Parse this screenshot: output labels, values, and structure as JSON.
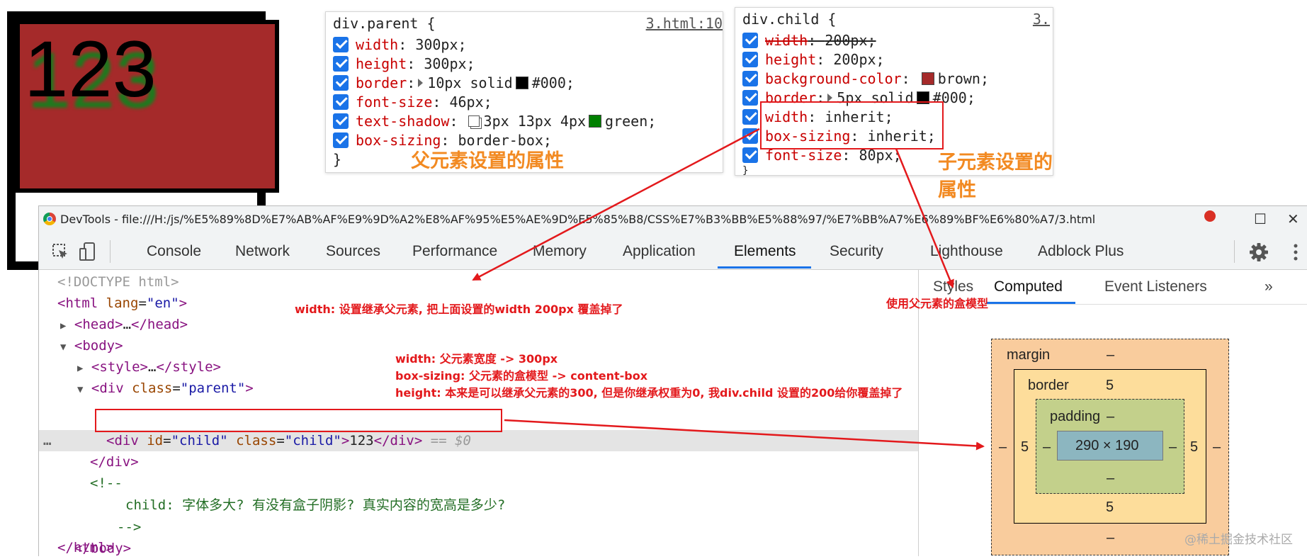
{
  "demo": {
    "text": "123"
  },
  "parent_panel": {
    "selector": "div.parent {",
    "source": "3.html:10",
    "props": [
      {
        "name": "width",
        "value": "300px;"
      },
      {
        "name": "height",
        "value": "300px;"
      },
      {
        "name": "border",
        "value_pre": "10px solid",
        "value_post": "#000;"
      },
      {
        "name": "font-size",
        "value": "46px;"
      },
      {
        "name": "text-shadow",
        "value_pre": "3px 13px 4px",
        "value_post": "green;"
      },
      {
        "name": "box-sizing",
        "value": "border-box;"
      }
    ],
    "close": "}",
    "annotation": "父元素设置的属性"
  },
  "child_panel": {
    "selector": "div.child {",
    "source": "3.",
    "props": [
      {
        "name": "width",
        "value": "200px;"
      },
      {
        "name": "height",
        "value": "200px;"
      },
      {
        "name": "background-color",
        "value": "brown;"
      },
      {
        "name": "border",
        "value_pre": "5px solid",
        "value_post": "#000;"
      },
      {
        "name": "width",
        "value": "inherit;"
      },
      {
        "name": "box-sizing",
        "value": "inherit;"
      },
      {
        "name": "font-size",
        "value": "80px;"
      }
    ],
    "close": "}",
    "annotation": "子元素设置的属性"
  },
  "devtools": {
    "title": "DevTools - file:///H:/js/%E5%89%8D%E7%AB%AF%E9%9D%A2%E8%AF%95%E5%AE%9D%E5%85%B8/CSS%E7%B3%BB%E5%88%97/%E7%BB%A7%E6%89%BF%E6%80%A7/3.html",
    "tabs": [
      "Console",
      "Network",
      "Sources",
      "Performance",
      "Memory",
      "Application",
      "Elements",
      "Security",
      "Lighthouse",
      "Adblock Plus"
    ],
    "active_tab": "Elements",
    "right_tabs": [
      "Styles",
      "Computed",
      "Event Listeners"
    ],
    "right_active": "Computed",
    "more_tabs": "»"
  },
  "dom": {
    "doctype": "<!DOCTYPE html>",
    "html_open_tag": "html",
    "html_lang_attr": "lang",
    "html_lang_val": "\"en\"",
    "head": "head",
    "head_ellipsis": "…",
    "body": "body",
    "style": "style",
    "style_ellipsis": "…",
    "div": "div",
    "class_attr": "class",
    "parent_val": "\"parent\"",
    "id_attr": "id",
    "child_val": "\"child\"",
    "child_text": "123",
    "eq": "== $0",
    "ellipsis_dots": "…",
    "comment_open": "<!--",
    "comment_label": "child:",
    "comment_text": "字体多大? 有没有盒子阴影? 真实内容的宽高是多少?",
    "comment_close": "-->",
    "body_close": "body",
    "html_close": "html"
  },
  "box_model": {
    "margin_label": "margin",
    "margin_top": "–",
    "margin_left": "–",
    "margin_right": "–",
    "margin_bottom": "–",
    "border_label": "border",
    "border_top": "5",
    "border_left": "5",
    "border_right": "5",
    "border_bottom": "5",
    "padding_label": "padding",
    "padding_top": "–",
    "padding_left": "–",
    "padding_right": "–",
    "padding_bottom": "–",
    "content": "290 × 190"
  },
  "annotations": {
    "width_note": "width: 设置继承父元素, 把上面设置的width 200px 覆盖掉了",
    "box_sizing_note": "使用父元素的盒模型",
    "detail_1": "width: 父元素宽度 -> 300px",
    "detail_2": "box-sizing: 父元素的盒模型 -> content-box",
    "detail_3": "height: 本来是可以继承父元素的300, 但是你继承权重为0, 我div.child 设置的200给你覆盖掉了"
  },
  "colors": {
    "brown": "#a52a2a",
    "green": "#008000",
    "black": "#000000",
    "accent": "#1a73e8",
    "annotation_red": "#e3191c",
    "annotation_orange": "#f28a22"
  },
  "watermark": "@稀土掘金技术社区"
}
